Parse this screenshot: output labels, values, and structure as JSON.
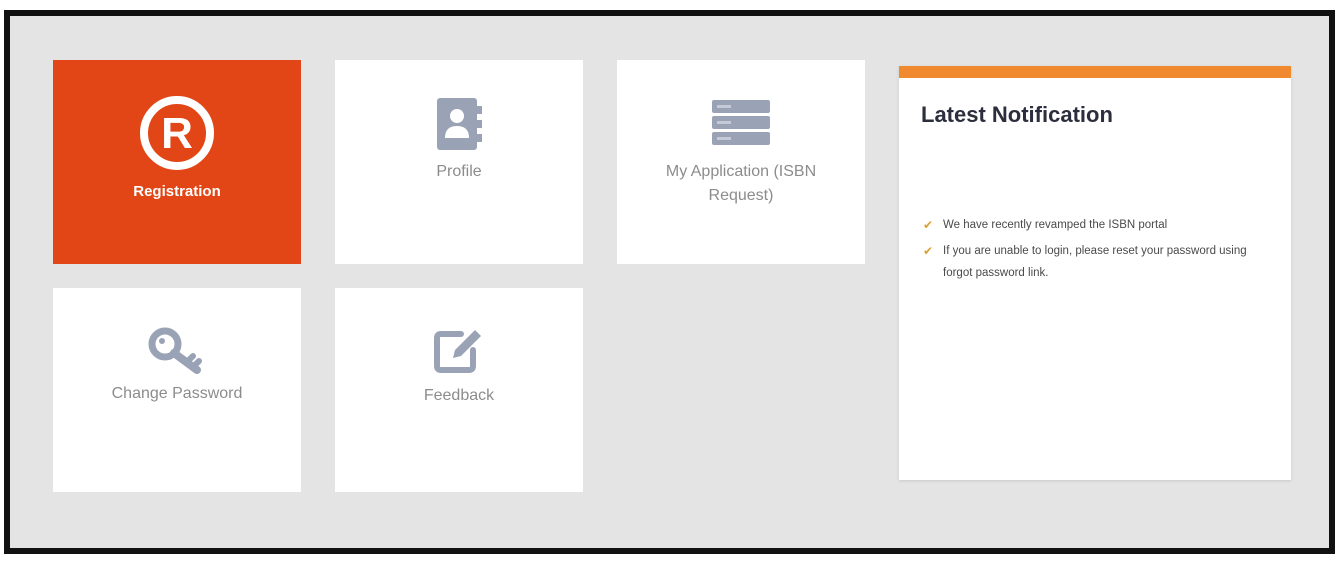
{
  "tiles": [
    {
      "key": "registration",
      "label": "Registration",
      "icon": "registered-icon"
    },
    {
      "key": "profile",
      "label": "Profile",
      "icon": "contact-book-icon"
    },
    {
      "key": "my_application",
      "label": "My Application (ISBN Request)",
      "icon": "server-list-icon"
    },
    {
      "key": "change_password",
      "label": "Change Password",
      "icon": "key-icon"
    },
    {
      "key": "feedback",
      "label": "Feedback",
      "icon": "edit-icon"
    }
  ],
  "notification": {
    "title": "Latest Notification",
    "items": [
      "We have recently revamped the ISBN portal",
      "If you are unable to login, please reset your password using forgot password link."
    ],
    "icon": "check-icon"
  },
  "colors": {
    "active_tile": "#e24616",
    "notification_accent": "#f18a2e",
    "icon_gray": "#9aa3b5",
    "background": "#e4e4e4"
  }
}
